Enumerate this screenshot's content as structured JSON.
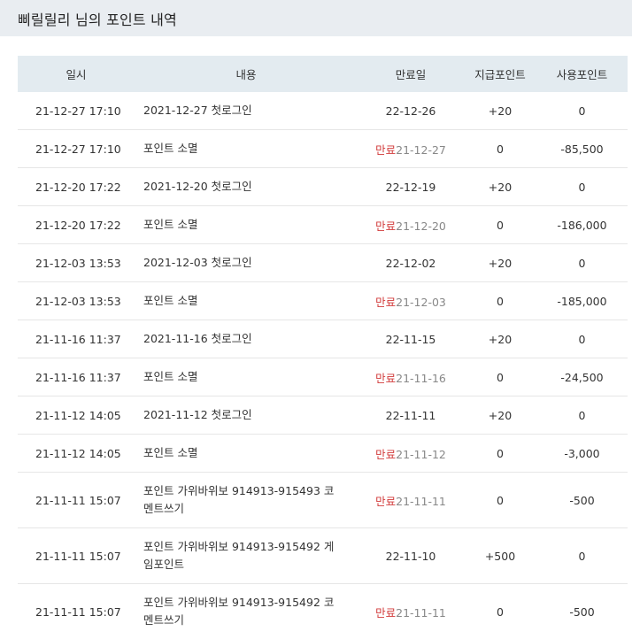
{
  "page_title": "삐릴릴리 님의 포인트 내역",
  "columns": {
    "date": "일시",
    "content": "내용",
    "expire": "만료일",
    "earned": "지급포인트",
    "used": "사용포인트"
  },
  "expired_label": "만료",
  "rows": [
    {
      "date": "21-12-27 17:10",
      "content": "2021-12-27 첫로그인",
      "expired": false,
      "expire_date": "22-12-26",
      "earned": "+20",
      "used": "0"
    },
    {
      "date": "21-12-27 17:10",
      "content": "포인트 소멸",
      "expired": true,
      "expire_date": "21-12-27",
      "earned": "0",
      "used": "-85,500"
    },
    {
      "date": "21-12-20 17:22",
      "content": "2021-12-20 첫로그인",
      "expired": false,
      "expire_date": "22-12-19",
      "earned": "+20",
      "used": "0"
    },
    {
      "date": "21-12-20 17:22",
      "content": "포인트 소멸",
      "expired": true,
      "expire_date": "21-12-20",
      "earned": "0",
      "used": "-186,000"
    },
    {
      "date": "21-12-03 13:53",
      "content": "2021-12-03 첫로그인",
      "expired": false,
      "expire_date": "22-12-02",
      "earned": "+20",
      "used": "0"
    },
    {
      "date": "21-12-03 13:53",
      "content": "포인트 소멸",
      "expired": true,
      "expire_date": "21-12-03",
      "earned": "0",
      "used": "-185,000"
    },
    {
      "date": "21-11-16 11:37",
      "content": "2021-11-16 첫로그인",
      "expired": false,
      "expire_date": "22-11-15",
      "earned": "+20",
      "used": "0"
    },
    {
      "date": "21-11-16 11:37",
      "content": "포인트 소멸",
      "expired": true,
      "expire_date": "21-11-16",
      "earned": "0",
      "used": "-24,500"
    },
    {
      "date": "21-11-12 14:05",
      "content": "2021-11-12 첫로그인",
      "expired": false,
      "expire_date": "22-11-11",
      "earned": "+20",
      "used": "0"
    },
    {
      "date": "21-11-12 14:05",
      "content": "포인트 소멸",
      "expired": true,
      "expire_date": "21-11-12",
      "earned": "0",
      "used": "-3,000"
    },
    {
      "date": "21-11-11 15:07",
      "content": "포인트 가위바위보 914913-915493 코멘트쓰기",
      "expired": true,
      "expire_date": "21-11-11",
      "earned": "0",
      "used": "-500"
    },
    {
      "date": "21-11-11 15:07",
      "content": "포인트 가위바위보 914913-915492 게임포인트",
      "expired": false,
      "expire_date": "22-11-10",
      "earned": "+500",
      "used": "0"
    },
    {
      "date": "21-11-11 15:07",
      "content": "포인트 가위바위보 914913-915492 코멘트쓰기",
      "expired": true,
      "expire_date": "21-11-11",
      "earned": "0",
      "used": "-500"
    }
  ]
}
